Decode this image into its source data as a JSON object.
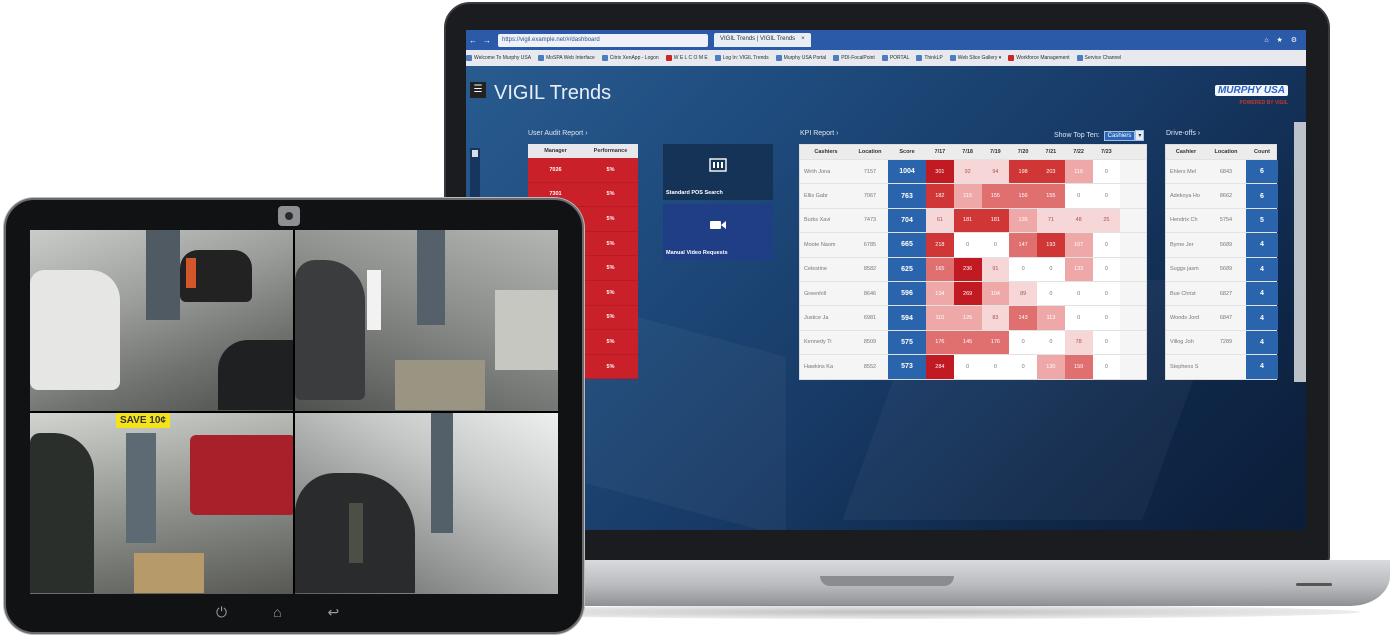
{
  "browser": {
    "address": "https://vigil.example.net/#/dashboard",
    "tab_title": "VIGIL Trends | VIGIL Trends",
    "tab_close": "×",
    "window_controls": "⌂ ★ ⚙",
    "favorites": [
      {
        "label": "Welcome To Murphy USA",
        "icon": "blue"
      },
      {
        "label": "MoSPA Web Interface",
        "icon": "blue"
      },
      {
        "label": "Citrix XenApp - Logon",
        "icon": "blue"
      },
      {
        "label": "W E L C O M E",
        "icon": "red"
      },
      {
        "label": "Log In: VIGIL Trends",
        "icon": "blue"
      },
      {
        "label": "Murphy USA Portal",
        "icon": "blue"
      },
      {
        "label": "PDI-FocalPoint",
        "icon": "blue"
      },
      {
        "label": "PORTAL",
        "icon": "blue"
      },
      {
        "label": "ThinkLP",
        "icon": "blue"
      },
      {
        "label": "Web Slice Gallery ▾",
        "icon": "blue"
      },
      {
        "label": "Workforce Management",
        "icon": "red"
      },
      {
        "label": "Service Channel",
        "icon": "blue"
      }
    ]
  },
  "app": {
    "menu_icon": "☰",
    "title": "VIGIL Trends",
    "brand_logo": "MURPHY USA",
    "brand_powered": "POWERED BY VIGIL"
  },
  "user_audit": {
    "title": "User Audit Report ›",
    "headers": [
      "Manager",
      "Performance"
    ],
    "rows": [
      [
        "7026",
        "5%"
      ],
      [
        "7301",
        "5%"
      ],
      [
        "",
        "5%"
      ],
      [
        "",
        "5%"
      ],
      [
        "",
        "5%"
      ],
      [
        "",
        "5%"
      ],
      [
        "",
        "5%"
      ],
      [
        "",
        "5%"
      ],
      [
        "",
        "5%"
      ]
    ]
  },
  "tiles": {
    "pos": "Standard POS Search",
    "video": "Manual Video Requests"
  },
  "kpi": {
    "title": "KPI Report ›",
    "show_top_label": "Show Top Ten:",
    "show_top_value": "Cashiers",
    "show_top_arrow": "▾",
    "headers": [
      "Cashiers",
      "Location",
      "Score",
      "7/17",
      "7/18",
      "7/19",
      "7/20",
      "7/21",
      "7/22",
      "7/23"
    ],
    "rows": [
      {
        "name": "Wirth Jona",
        "loc": "7157",
        "score": "1004",
        "days": [
          "301",
          "92",
          "94",
          "198",
          "203",
          "116",
          "0"
        ]
      },
      {
        "name": "Ellis Gabr",
        "loc": "7067",
        "score": "763",
        "days": [
          "182",
          "115",
          "155",
          "156",
          "155",
          "0",
          "0"
        ]
      },
      {
        "name": "Burks Xavi",
        "loc": "7473",
        "score": "704",
        "days": [
          "61",
          "181",
          "181",
          "135",
          "71",
          "48",
          "25"
        ]
      },
      {
        "name": "Moote Naom",
        "loc": "6785",
        "score": "665",
        "days": [
          "218",
          "0",
          "0",
          "147",
          "193",
          "107",
          "0"
        ]
      },
      {
        "name": "Celestine",
        "loc": "8582",
        "score": "625",
        "days": [
          "165",
          "236",
          "91",
          "0",
          "0",
          "133",
          "0"
        ]
      },
      {
        "name": "Greenhill",
        "loc": "8646",
        "score": "596",
        "days": [
          "134",
          "269",
          "104",
          "89",
          "0",
          "0",
          "0"
        ]
      },
      {
        "name": "Justice Ja",
        "loc": "6981",
        "score": "594",
        "days": [
          "110",
          "126",
          "83",
          "143",
          "113",
          "0",
          "0"
        ]
      },
      {
        "name": "Kennedy Ti",
        "loc": "8509",
        "score": "575",
        "days": [
          "176",
          "145",
          "176",
          "0",
          "0",
          "78",
          "0"
        ]
      },
      {
        "name": "Hawkins Ka",
        "loc": "8552",
        "score": "573",
        "days": [
          "284",
          "0",
          "0",
          "0",
          "130",
          "159",
          "0"
        ]
      }
    ],
    "heat_colors": [
      "#ffffff",
      "#f6d6d6",
      "#eea8a8",
      "#e06f6f",
      "#d03636",
      "#c21a22"
    ]
  },
  "driveoffs": {
    "title": "Drive-offs ›",
    "headers": [
      "Cashier",
      "Location",
      "Count"
    ],
    "rows": [
      [
        "Ehlers Mel",
        "6843",
        "6"
      ],
      [
        "Adekoya Ho",
        "8662",
        "6"
      ],
      [
        "Hendrix Ch",
        "5754",
        "5"
      ],
      [
        "Byrne Jer",
        "5689",
        "4"
      ],
      [
        "Suggs jasm",
        "5689",
        "4"
      ],
      [
        "Bue Christ",
        "6827",
        "4"
      ],
      [
        "Woods Jord",
        "6847",
        "4"
      ],
      [
        "Villog Joh",
        "7289",
        "4"
      ],
      [
        "Stephens S",
        "",
        "4"
      ]
    ]
  },
  "tablet": {
    "feeds": [
      "camera-feed-pump-northwest",
      "camera-feed-pump-northeast",
      "camera-feed-pump-southwest",
      "camera-feed-pump-southeast"
    ],
    "promo_sign": "SAVE 10¢",
    "nav_power": "⏻",
    "nav_home": "⌂",
    "nav_back": "↩"
  }
}
